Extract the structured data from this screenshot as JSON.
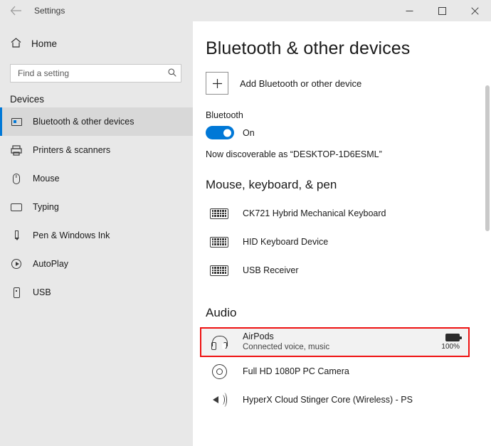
{
  "window": {
    "title": "Settings",
    "back_icon": "back-arrow-icon",
    "minimize_label": "─",
    "maximize_label": "☐",
    "close_label": "✕"
  },
  "sidebar": {
    "home_label": "Home",
    "home_icon": "home-icon",
    "search": {
      "placeholder": "Find a setting",
      "value": "",
      "icon": "search-icon"
    },
    "section_label": "Devices",
    "items": [
      {
        "label": "Bluetooth & other devices",
        "icon": "bluetooth-devices-icon",
        "selected": true
      },
      {
        "label": "Printers & scanners",
        "icon": "printer-icon",
        "selected": false
      },
      {
        "label": "Mouse",
        "icon": "mouse-icon",
        "selected": false
      },
      {
        "label": "Typing",
        "icon": "keyboard-icon",
        "selected": false
      },
      {
        "label": "Pen & Windows Ink",
        "icon": "pen-icon",
        "selected": false
      },
      {
        "label": "AutoPlay",
        "icon": "autoplay-icon",
        "selected": false
      },
      {
        "label": "USB",
        "icon": "usb-icon",
        "selected": false
      }
    ]
  },
  "main": {
    "page_title": "Bluetooth & other devices",
    "add_device": {
      "label": "Add Bluetooth or other device",
      "icon": "plus-icon"
    },
    "bluetooth": {
      "label": "Bluetooth",
      "state": "On",
      "toggle_on": true,
      "discoverable": "Now discoverable as “DESKTOP-1D6ESML”"
    },
    "groups": [
      {
        "title": "Mouse, keyboard, & pen",
        "devices": [
          {
            "name": "CK721 Hybrid Mechanical Keyboard",
            "icon": "keyboard-icon"
          },
          {
            "name": "HID Keyboard Device",
            "icon": "keyboard-icon"
          },
          {
            "name": "USB Receiver",
            "icon": "keyboard-icon"
          }
        ]
      },
      {
        "title": "Audio",
        "devices": [
          {
            "name": "AirPods",
            "status": "Connected voice, music",
            "icon": "headset-icon",
            "battery": "100%",
            "battery_icon": "battery-full-icon",
            "highlighted": true
          },
          {
            "name": "Full HD 1080P PC Camera",
            "icon": "camera-icon"
          },
          {
            "name": "HyperX Cloud Stinger Core (Wireless) - PS",
            "icon": "speaker-icon"
          }
        ]
      }
    ]
  },
  "colors": {
    "accent": "#0078d7",
    "highlight_border": "#ee1111",
    "sidebar_bg": "#e8e8e8",
    "titlebar_bg": "#e8e8e8"
  }
}
